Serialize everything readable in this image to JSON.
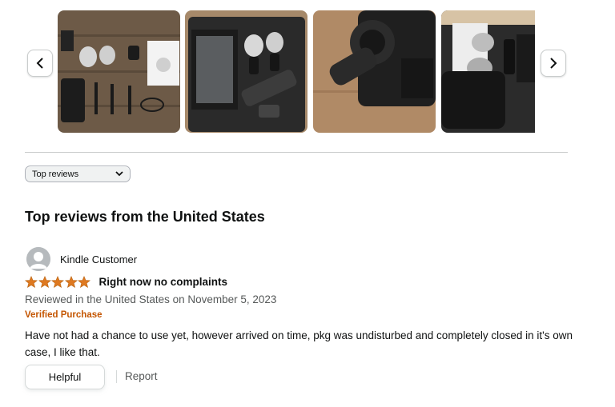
{
  "carousel": {
    "prev_icon": "chevron-left-icon",
    "next_icon": "chevron-right-icon",
    "images": [
      {
        "name": "review-image-kit-contents"
      },
      {
        "name": "review-image-case"
      },
      {
        "name": "review-image-camera-mic"
      },
      {
        "name": "review-image-accessories"
      }
    ]
  },
  "sort": {
    "selected": "Top reviews",
    "icon": "chevron-down-icon"
  },
  "section": {
    "heading": "Top reviews from the United States"
  },
  "review": {
    "profile_name": "Kindle Customer",
    "stars": 5,
    "title": "Right now no complaints",
    "date_line": "Reviewed in the United States on November 5, 2023",
    "badge": "Verified Purchase",
    "body": "Have not had a chance to use yet, however arrived on time, pkg was undisturbed and completely closed in it's own case, I like that.",
    "helpful_label": "Helpful",
    "report_label": "Report"
  },
  "colors": {
    "star": "#de7921",
    "verified": "#c45500",
    "muted_text": "#565959"
  }
}
